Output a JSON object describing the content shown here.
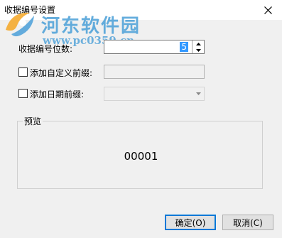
{
  "window": {
    "title": "收据编号设置",
    "close_icon": "close-icon"
  },
  "watermark": {
    "logo_icon": "watermark-logo",
    "title": "河东软件园",
    "url": "www.pc0359.cn",
    "color": "#4a9fd8"
  },
  "form": {
    "digits_label": "收据编号位数:",
    "digits_value": "5",
    "custom_prefix_label": "添加自定义前缀:",
    "custom_prefix_checked": false,
    "custom_prefix_value": "",
    "date_prefix_label": "添加日期前缀:",
    "date_prefix_checked": false,
    "date_prefix_value": ""
  },
  "preview": {
    "title": "预览",
    "value": "00001"
  },
  "buttons": {
    "ok": "确定(O)",
    "cancel": "取消(C)"
  },
  "colors": {
    "dialog_bg": "#f0f0f0",
    "selection": "#3399ff",
    "focus_border": "#0078d7"
  }
}
